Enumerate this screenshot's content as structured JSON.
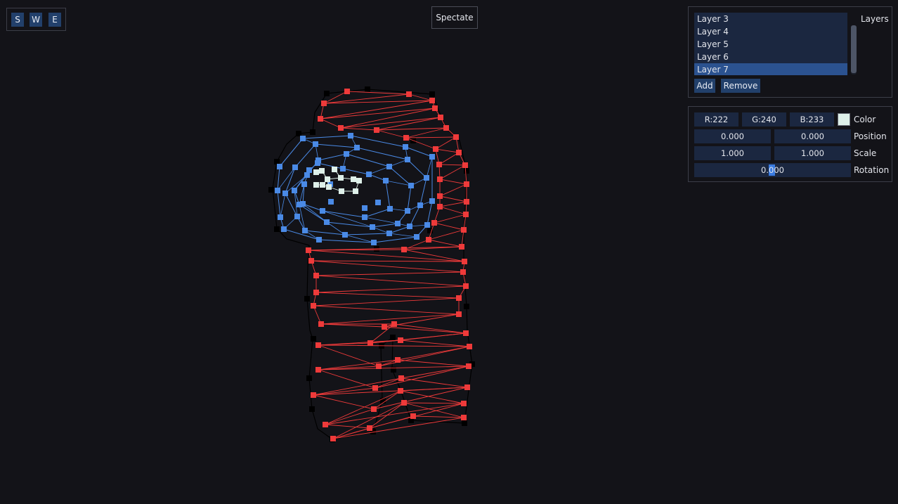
{
  "toolbar": {
    "modes": [
      "S",
      "W",
      "E"
    ]
  },
  "spectate_label": "Spectate",
  "layers": {
    "title": "Layers",
    "items": [
      "Layer 3",
      "Layer 4",
      "Layer 5",
      "Layer 6",
      "Layer 7"
    ],
    "selected": "Layer 7",
    "add_label": "Add",
    "remove_label": "Remove"
  },
  "properties": {
    "color": {
      "label": "Color",
      "r": "R:222",
      "g": "G:240",
      "b": "B:233",
      "swatch": "#def0e9"
    },
    "position": {
      "label": "Position",
      "x": "0.000",
      "y": "0.000"
    },
    "scale": {
      "label": "Scale",
      "x": "1.000",
      "y": "1.000"
    },
    "rotation": {
      "label": "Rotation",
      "value": "0.000"
    }
  },
  "colors": {
    "body_mesh": "#ef3a3a",
    "visor_mesh": "#4a8ae6",
    "highlight_mesh": "#def0e9",
    "outline": "#000000"
  }
}
